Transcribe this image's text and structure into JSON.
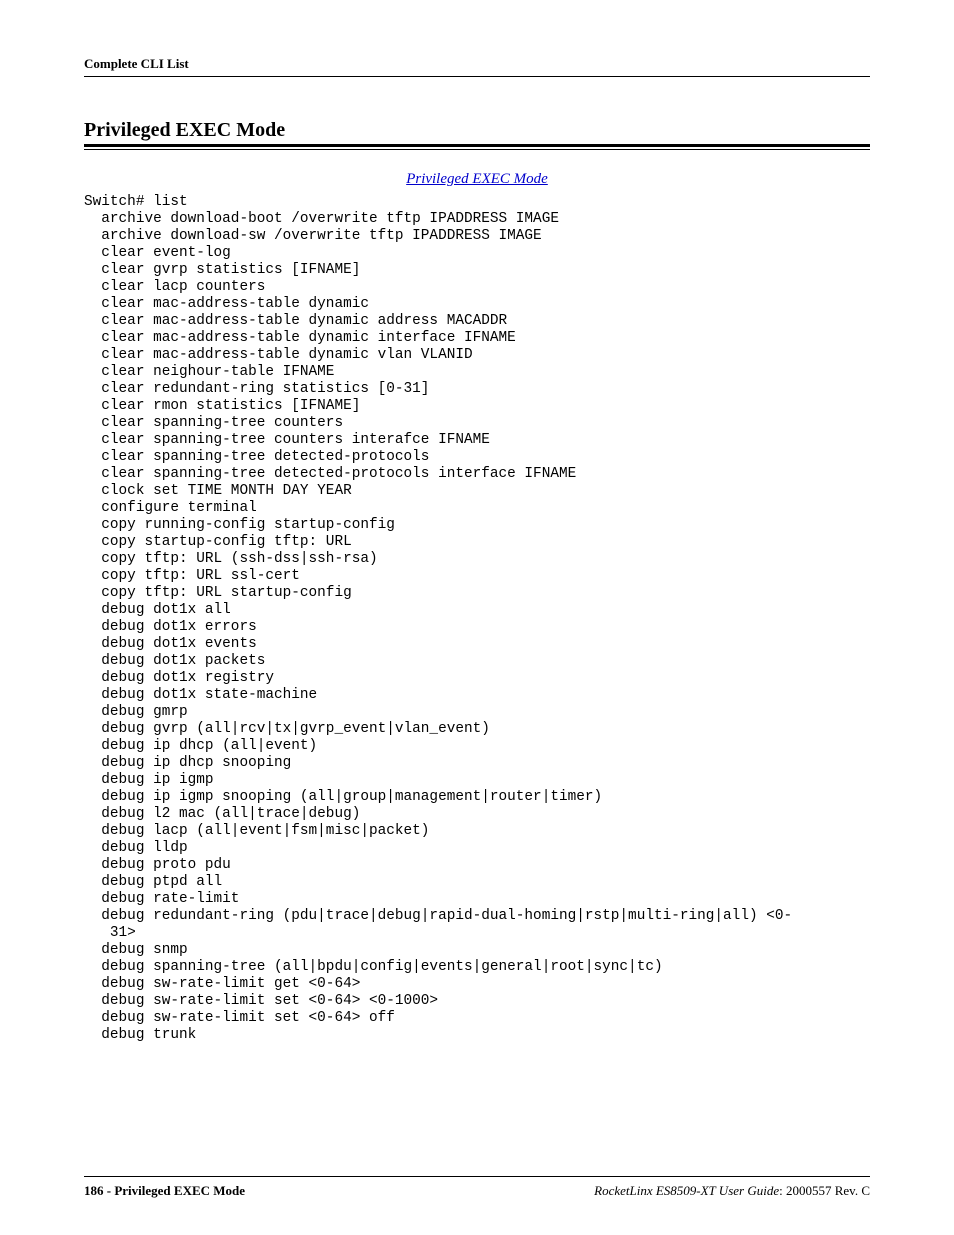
{
  "header": {
    "title": "Complete CLI List"
  },
  "section": {
    "title": "Privileged EXEC Mode"
  },
  "link": {
    "label": "Privileged EXEC Mode"
  },
  "code": {
    "prompt": "Switch# list",
    "lines": [
      "archive download-boot /overwrite tftp IPADDRESS IMAGE",
      "archive download-sw /overwrite tftp IPADDRESS IMAGE",
      "clear event-log",
      "clear gvrp statistics [IFNAME]",
      "clear lacp counters",
      "clear mac-address-table dynamic",
      "clear mac-address-table dynamic address MACADDR",
      "clear mac-address-table dynamic interface IFNAME",
      "clear mac-address-table dynamic vlan VLANID",
      "clear neighour-table IFNAME",
      "clear redundant-ring statistics [0-31]",
      "clear rmon statistics [IFNAME]",
      "clear spanning-tree counters",
      "clear spanning-tree counters interafce IFNAME",
      "clear spanning-tree detected-protocols",
      "clear spanning-tree detected-protocols interface IFNAME",
      "clock set TIME MONTH DAY YEAR",
      "configure terminal",
      "copy running-config startup-config",
      "copy startup-config tftp: URL",
      "copy tftp: URL (ssh-dss|ssh-rsa)",
      "copy tftp: URL ssl-cert",
      "copy tftp: URL startup-config",
      "debug dot1x all",
      "debug dot1x errors",
      "debug dot1x events",
      "debug dot1x packets",
      "debug dot1x registry",
      "debug dot1x state-machine",
      "debug gmrp",
      "debug gvrp (all|rcv|tx|gvrp_event|vlan_event)",
      "debug ip dhcp (all|event)",
      "debug ip dhcp snooping",
      "debug ip igmp",
      "debug ip igmp snooping (all|group|management|router|timer)",
      "debug l2 mac (all|trace|debug)",
      "debug lacp (all|event|fsm|misc|packet)",
      "debug lldp",
      "debug proto pdu",
      "debug ptpd all",
      "debug rate-limit",
      "debug redundant-ring (pdu|trace|debug|rapid-dual-homing|rstp|multi-ring|all) <0-",
      " 31>",
      "debug snmp",
      "debug spanning-tree (all|bpdu|config|events|general|root|sync|tc)",
      "debug sw-rate-limit get <0-64>",
      "debug sw-rate-limit set <0-64> <0-1000>",
      "debug sw-rate-limit set <0-64> off",
      "debug trunk"
    ]
  },
  "footer": {
    "left": "186 - Privileged EXEC Mode",
    "right_product": "RocketLinx ES8509-XT User Guide",
    "right_rev": ": 2000557 Rev. C"
  }
}
